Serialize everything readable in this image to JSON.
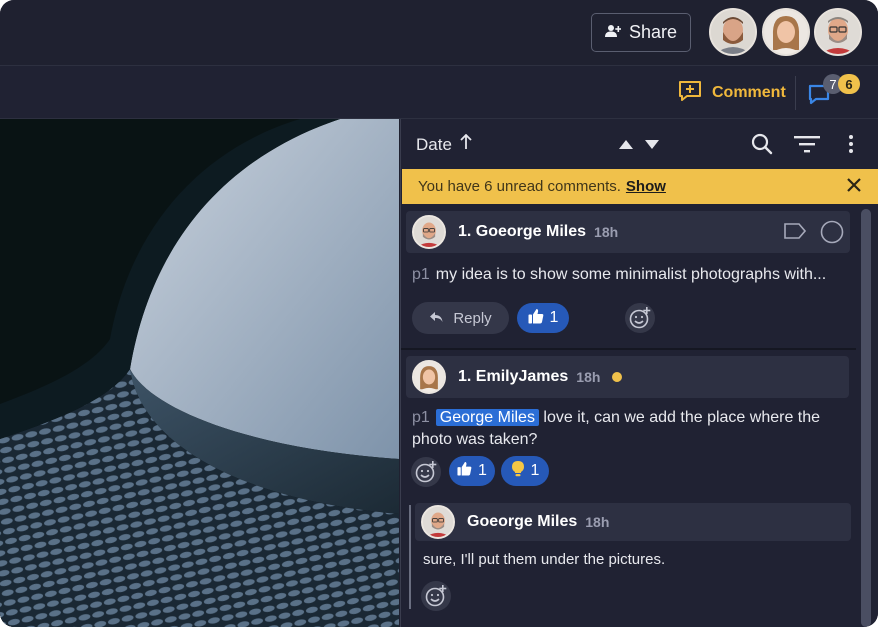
{
  "topbar": {
    "share_label": "Share",
    "avatars": [
      "bearded man",
      "woman",
      "man with glasses"
    ]
  },
  "secbar": {
    "comment_label": "Comment",
    "badge_count_gray": "7",
    "badge_count_yellow": "6"
  },
  "panel": {
    "sort_label": "Date",
    "banner_text": "You have 6 unread comments.",
    "banner_link": "Show"
  },
  "comments": [
    {
      "name": "1. Goeorge Miles",
      "time": "18h",
      "page": "p1",
      "text": "my idea is to show some minimalist photographs with...",
      "reply_label": "Reply",
      "thumbs_count": "1"
    },
    {
      "name": "1. EmilyJames",
      "time": "18h",
      "page": "p1",
      "mention": "George Miles",
      "text_line1": "love it, can we add the place where the",
      "text_line2": "photo was taken?",
      "thumbs_count": "1",
      "bulb_count": "1"
    },
    {
      "name": "Goeorge Miles",
      "time": "18h",
      "text": "sure, I'll put them under the pictures."
    }
  ],
  "colors": {
    "accent_yellow": "#f0c14b",
    "accent_blue": "#2659b8",
    "background": "#202233"
  }
}
